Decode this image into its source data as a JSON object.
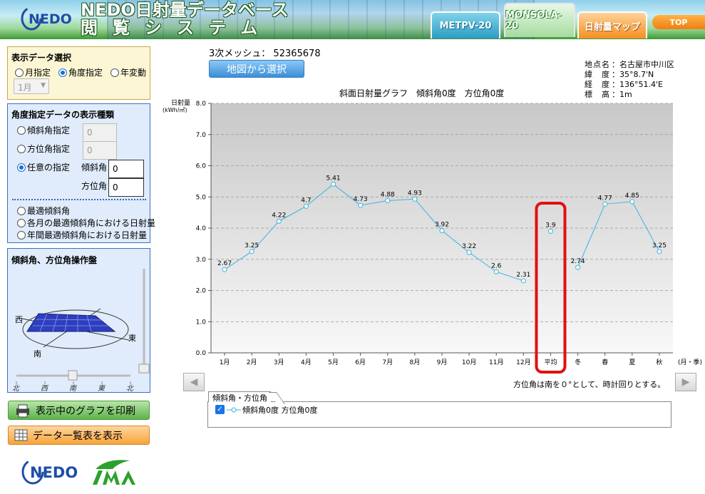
{
  "header": {
    "logo_text": "NEDO",
    "title_line1": "NEDO日射量データベース",
    "title_line2": "閲覧システム",
    "tabs": [
      {
        "label": "METPV-20"
      },
      {
        "label": "MONSOLA-20"
      },
      {
        "label": "日射量マップ"
      }
    ],
    "top_label": "TOP"
  },
  "display_panel": {
    "title": "表示データ選択",
    "options": [
      "月指定",
      "角度指定",
      "年変動"
    ],
    "selected": "角度指定",
    "month_value": "1月"
  },
  "kind_panel": {
    "title": "角度指定データの表示種類",
    "tilt_label": "傾斜角指定",
    "tilt_value": "0",
    "azimuth_label": "方位角指定",
    "azimuth_value": "0",
    "custom_label": "任意の指定",
    "custom_tilt_label": "傾斜角",
    "custom_tilt_value": "0",
    "custom_azimuth_label": "方位角",
    "custom_azimuth_value": "0",
    "option_optimal": "最適傾斜角",
    "option_monthly_optimal": "各月の最適傾斜角における日射量",
    "option_annual_optimal": "年間最適傾斜角における日射量"
  },
  "ops_panel": {
    "title": "傾斜角、方位角操作盤",
    "west": "西",
    "east": "東",
    "south": "南",
    "scale_labels": [
      "北",
      "西",
      "南",
      "東",
      "北"
    ]
  },
  "buttons": {
    "print": "表示中のグラフを印刷",
    "table": "データ一覧表を表示",
    "map_select": "地図から選択"
  },
  "mesh": {
    "label": "3次メッシュ：",
    "code": "52365678"
  },
  "location": {
    "rows": [
      {
        "k": "地点名",
        "v": "：名古屋市中川区"
      },
      {
        "k": "緯　度",
        "v": "：35°8.7'N"
      },
      {
        "k": "経　度",
        "v": "：136°51.4'E"
      },
      {
        "k": "標　高",
        "v": "：1m"
      }
    ]
  },
  "azimuth_note": "方位角は南を０°として、時計回りとする。",
  "legend": {
    "tab_label": "傾斜角・方位角",
    "item_label": "傾斜角0度 方位角0度",
    "checked": true
  },
  "colors": {
    "series": "#3ab4e0",
    "highlight": "#e01010",
    "plot_top": "#c8c8c8",
    "plot_bottom": "#f8f8f8"
  },
  "chart_data": {
    "type": "line",
    "title": "斜面日射量グラフ　傾斜角0度　方位角0度",
    "ylabel": "日射量",
    "yunit": "(kWh/㎡)",
    "xunit": "(月・季)",
    "ylim": [
      0,
      8
    ],
    "yticks": [
      "0.0",
      "1.0",
      "2.0",
      "3.0",
      "4.0",
      "5.0",
      "6.0",
      "7.0",
      "8.0"
    ],
    "grid": true,
    "categories": [
      "1月",
      "2月",
      "3月",
      "4月",
      "5月",
      "6月",
      "7月",
      "8月",
      "9月",
      "10月",
      "11月",
      "12月",
      "平均",
      "冬",
      "春",
      "夏",
      "秋"
    ],
    "series": [
      {
        "values": [
          2.67,
          3.25,
          4.22,
          4.7,
          5.41,
          4.73,
          4.88,
          4.93,
          3.92,
          3.22,
          2.6,
          2.31,
          3.9,
          2.74,
          4.77,
          4.85,
          3.25
        ],
        "labels": [
          "2.67",
          "3.25",
          "4.22",
          "4.7",
          "5.41",
          "4.73",
          "4.88",
          "4.93",
          "3.92",
          "3.22",
          "2.6",
          "2.31",
          "3.9",
          "2.74",
          "4.77",
          "4.85",
          "3.25"
        ]
      }
    ],
    "line_breaks_after": [
      11,
      12
    ],
    "highlighted_category": "平均"
  }
}
